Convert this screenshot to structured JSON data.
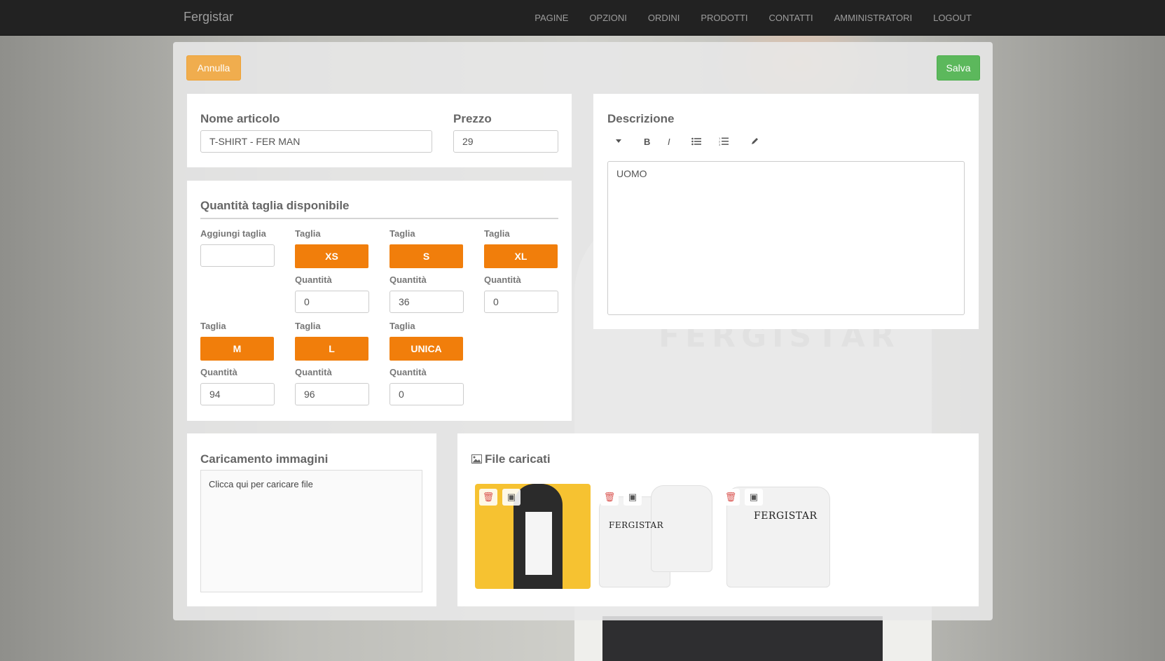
{
  "brand": "Fergistar",
  "nav": [
    "PAGINE",
    "OPZIONI",
    "ORDINI",
    "PRODOTTI",
    "CONTATTI",
    "AMMINISTRATORI",
    "LOGOUT"
  ],
  "actions": {
    "cancel": "Annulla",
    "save": "Salva"
  },
  "product": {
    "name_label": "Nome articolo",
    "name_value": "T-SHIRT - FER MAN",
    "price_label": "Prezzo",
    "price_value": "29"
  },
  "sizes": {
    "title": "Quantità taglia disponibile",
    "add_label": "Aggiungi taglia",
    "add_value": "",
    "size_label": "Taglia",
    "qty_label": "Quantità",
    "items": [
      {
        "size": "XS",
        "qty": "0"
      },
      {
        "size": "S",
        "qty": "36"
      },
      {
        "size": "XL",
        "qty": "0"
      },
      {
        "size": "M",
        "qty": "94"
      },
      {
        "size": "L",
        "qty": "96"
      },
      {
        "size": "UNICA",
        "qty": "0"
      }
    ]
  },
  "description": {
    "label": "Descrizione",
    "toolbar": [
      "caret-down-icon",
      "bold-icon",
      "italic-icon",
      "bullet-list-icon",
      "numbered-list-icon",
      "pencil-icon"
    ],
    "content": "UOMO"
  },
  "upload": {
    "title": "Caricamento immagini",
    "hint": "Clicca qui per caricare file"
  },
  "files": {
    "title": "File caricati",
    "thumb_logo_text": "FERGISTAR"
  },
  "colors": {
    "navbar": "#222222",
    "cancel": "#f0ad4e",
    "save": "#5cb85c",
    "size_button": "#f17e0b",
    "delete": "#d9534f"
  }
}
